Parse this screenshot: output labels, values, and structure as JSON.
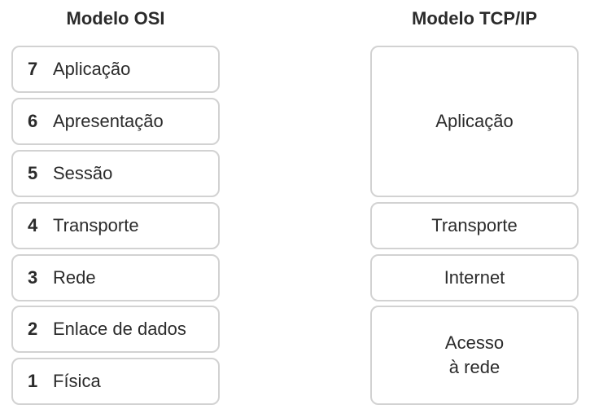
{
  "osi": {
    "title": "Modelo OSI",
    "layers": [
      {
        "number": "7",
        "name": "Aplicação"
      },
      {
        "number": "6",
        "name": "Apresentação"
      },
      {
        "number": "5",
        "name": "Sessão"
      },
      {
        "number": "4",
        "name": "Transporte"
      },
      {
        "number": "3",
        "name": "Rede"
      },
      {
        "number": "2",
        "name": "Enlace de dados"
      },
      {
        "number": "1",
        "name": "Física"
      }
    ]
  },
  "tcpip": {
    "title": "Modelo TCP/IP",
    "layers": [
      {
        "name": "Aplicação"
      },
      {
        "name": "Transporte"
      },
      {
        "name": "Internet"
      },
      {
        "name": "Acesso\nà rede"
      }
    ]
  }
}
